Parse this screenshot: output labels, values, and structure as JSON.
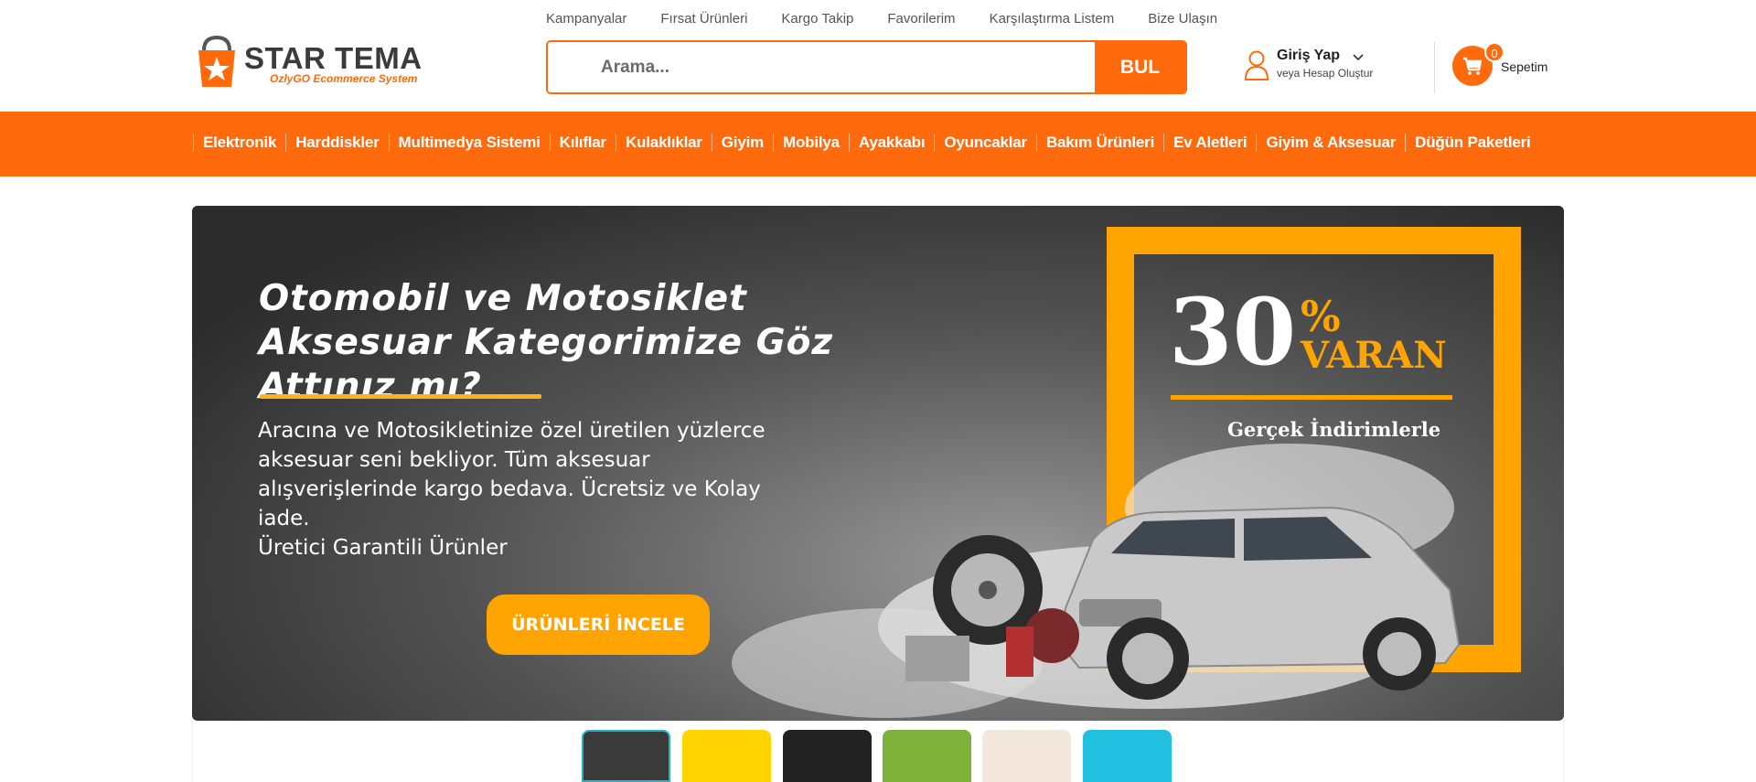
{
  "header": {
    "logo_text": "STAR TEMA",
    "logo_sub": "OzlyGO Ecommerce System",
    "top_links": [
      "Kampanyalar",
      "Fırsat Ürünleri",
      "Kargo Takip",
      "Favorilerim",
      "Karşılaştırma Listem",
      "Bize Ulaşın"
    ],
    "search_placeholder": "Arama...",
    "search_button": "BUL",
    "login_label": "Giriş Yap",
    "register_label": "veya Hesap Oluştur",
    "cart_count": "0",
    "cart_label": "Sepetim",
    "accent_color": "#ff6b0c"
  },
  "nav": {
    "items": [
      "Elektronik",
      "Harddiskler",
      "Multimedya Sistemi",
      "Kılıflar",
      "Kulaklıklar",
      "Giyim",
      "Mobilya",
      "Ayakkabı",
      "Oyuncaklar",
      "Bakım Ürünleri",
      "Ev Aletleri",
      "Giyim & Aksesuar",
      "Düğün Paketleri"
    ]
  },
  "banner": {
    "title": "Otomobil ve Motosiklet Aksesuar Kategorimize Göz Attınız mı?",
    "description": "Aracına ve Motosikletinize özel üretilen yüzlerce aksesuar seni bekliyor. Tüm aksesuar alışverişlerinde kargo bedava. Ücretsiz ve Kolay iade.",
    "guarantee": "Üretici Garantili Ürünler",
    "button": "ÜRÜNLERİ İNCELE",
    "discount_number": "30",
    "discount_pct": "%",
    "discount_word": "VARAN",
    "discount_sub": "Gerçek İndirimlerle"
  },
  "thumbnails": [
    {
      "label": "slide-1",
      "color": "#3a3a3a"
    },
    {
      "label": "slide-2",
      "color": "#ffd400"
    },
    {
      "label": "slide-3",
      "color": "#222222"
    },
    {
      "label": "slide-4",
      "color": "#7fb23a"
    },
    {
      "label": "slide-5",
      "color": "#f3e6da"
    },
    {
      "label": "slide-6",
      "color": "#22c0e0"
    }
  ]
}
